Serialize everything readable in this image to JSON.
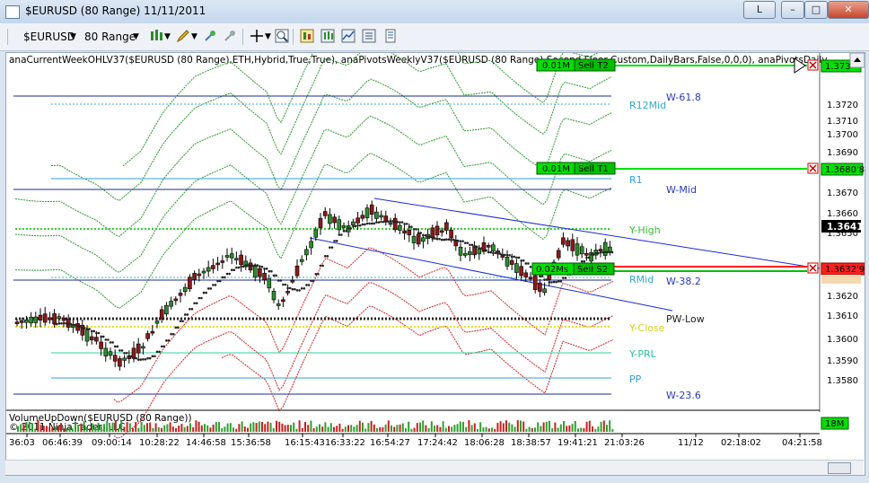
{
  "window": {
    "title": "$EURUSD (80 Range)  11/11/2011",
    "lang_label": "L",
    "minimize": "–",
    "maximize": "□",
    "close": "✕"
  },
  "toolbar": {
    "instrument": "$EURUSD",
    "period": "80 Range"
  },
  "indicator_caption": "anaCurrentWeekOHLV37($EURUSD (80 Range),ETH,Hybrid,True,True), anaPivotsWeeklyV37($EURUSD (80 Range),Second Floor,Custom,DailyBars,False,0,0,0), anaPivotsDaily",
  "volume_caption": "VolumeUpDown($EURUSD (80 Range))",
  "copyright": "© 2011 NinjaTrader, LLC",
  "levels": {
    "w618": "W-61.8",
    "r12mid": "R12Mid",
    "r1": "R1",
    "wmid": "W-Mid",
    "yhigh": "Y-High",
    "rmid": "RMid",
    "w382": "W-38.2",
    "pwlow": "PW-Low",
    "yclose": "Y-Close",
    "yprl": "Y-PRL",
    "pp": "PP",
    "w236": "W-23.6"
  },
  "orders": {
    "t2_qty": "0.01M",
    "t2_label": "Sell T2",
    "t2_price": "1.373",
    "t1_qty": "0.01M",
    "t1_label": "Sell T1",
    "t1_price": "1.3680'8",
    "s2_qty": "0.02Ms",
    "s2_label": "Sell S2",
    "s2_price": "1.3632'9"
  },
  "last_price": "1.3641",
  "volume_value": "18M",
  "price_axis": [
    "1.3720",
    "1.3710",
    "1.3700",
    "1.3690",
    "1.3670",
    "1.3660",
    "1.3650",
    "1.3630",
    "1.3620",
    "1.3610",
    "1.3600",
    "1.3590",
    "1.3580"
  ],
  "time_axis": [
    "36:03",
    "06:46:39",
    "09:00:14",
    "10:28:22",
    "14:46:58",
    "15:36:58",
    "16:15:43",
    "16:33:22",
    "16:54:27",
    "17:24:42",
    "18:06:28",
    "18:38:57",
    "19:41:21",
    "21:03:26",
    "11/12",
    "02:18:02",
    "04:21:58"
  ],
  "colors": {
    "bull": "#2e8b2e",
    "bear": "#8b1a1a",
    "buy_green": "#00e000",
    "sell_red": "#ff2020"
  }
}
